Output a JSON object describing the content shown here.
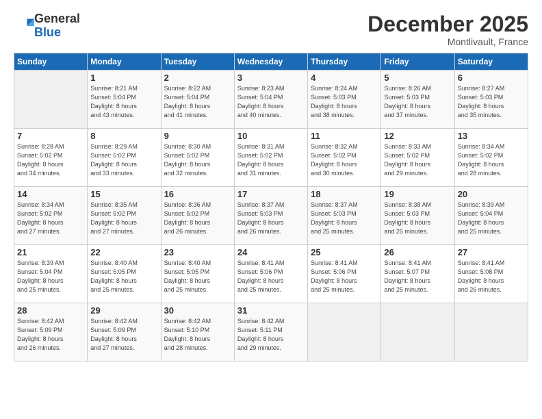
{
  "header": {
    "logo_general": "General",
    "logo_blue": "Blue",
    "month_title": "December 2025",
    "location": "Montlivault, France"
  },
  "days_of_week": [
    "Sunday",
    "Monday",
    "Tuesday",
    "Wednesday",
    "Thursday",
    "Friday",
    "Saturday"
  ],
  "weeks": [
    [
      {
        "day": "",
        "info": ""
      },
      {
        "day": "1",
        "info": "Sunrise: 8:21 AM\nSunset: 5:04 PM\nDaylight: 8 hours\nand 43 minutes."
      },
      {
        "day": "2",
        "info": "Sunrise: 8:22 AM\nSunset: 5:04 PM\nDaylight: 8 hours\nand 41 minutes."
      },
      {
        "day": "3",
        "info": "Sunrise: 8:23 AM\nSunset: 5:04 PM\nDaylight: 8 hours\nand 40 minutes."
      },
      {
        "day": "4",
        "info": "Sunrise: 8:24 AM\nSunset: 5:03 PM\nDaylight: 8 hours\nand 38 minutes."
      },
      {
        "day": "5",
        "info": "Sunrise: 8:26 AM\nSunset: 5:03 PM\nDaylight: 8 hours\nand 37 minutes."
      },
      {
        "day": "6",
        "info": "Sunrise: 8:27 AM\nSunset: 5:03 PM\nDaylight: 8 hours\nand 35 minutes."
      }
    ],
    [
      {
        "day": "7",
        "info": "Sunrise: 8:28 AM\nSunset: 5:02 PM\nDaylight: 8 hours\nand 34 minutes."
      },
      {
        "day": "8",
        "info": "Sunrise: 8:29 AM\nSunset: 5:02 PM\nDaylight: 8 hours\nand 33 minutes."
      },
      {
        "day": "9",
        "info": "Sunrise: 8:30 AM\nSunset: 5:02 PM\nDaylight: 8 hours\nand 32 minutes."
      },
      {
        "day": "10",
        "info": "Sunrise: 8:31 AM\nSunset: 5:02 PM\nDaylight: 8 hours\nand 31 minutes."
      },
      {
        "day": "11",
        "info": "Sunrise: 8:32 AM\nSunset: 5:02 PM\nDaylight: 8 hours\nand 30 minutes."
      },
      {
        "day": "12",
        "info": "Sunrise: 8:33 AM\nSunset: 5:02 PM\nDaylight: 8 hours\nand 29 minutes."
      },
      {
        "day": "13",
        "info": "Sunrise: 8:34 AM\nSunset: 5:02 PM\nDaylight: 8 hours\nand 28 minutes."
      }
    ],
    [
      {
        "day": "14",
        "info": "Sunrise: 8:34 AM\nSunset: 5:02 PM\nDaylight: 8 hours\nand 27 minutes."
      },
      {
        "day": "15",
        "info": "Sunrise: 8:35 AM\nSunset: 5:02 PM\nDaylight: 8 hours\nand 27 minutes."
      },
      {
        "day": "16",
        "info": "Sunrise: 8:36 AM\nSunset: 5:02 PM\nDaylight: 8 hours\nand 26 minutes."
      },
      {
        "day": "17",
        "info": "Sunrise: 8:37 AM\nSunset: 5:03 PM\nDaylight: 8 hours\nand 26 minutes."
      },
      {
        "day": "18",
        "info": "Sunrise: 8:37 AM\nSunset: 5:03 PM\nDaylight: 8 hours\nand 25 minutes."
      },
      {
        "day": "19",
        "info": "Sunrise: 8:38 AM\nSunset: 5:03 PM\nDaylight: 8 hours\nand 25 minutes."
      },
      {
        "day": "20",
        "info": "Sunrise: 8:39 AM\nSunset: 5:04 PM\nDaylight: 8 hours\nand 25 minutes."
      }
    ],
    [
      {
        "day": "21",
        "info": "Sunrise: 8:39 AM\nSunset: 5:04 PM\nDaylight: 8 hours\nand 25 minutes."
      },
      {
        "day": "22",
        "info": "Sunrise: 8:40 AM\nSunset: 5:05 PM\nDaylight: 8 hours\nand 25 minutes."
      },
      {
        "day": "23",
        "info": "Sunrise: 8:40 AM\nSunset: 5:05 PM\nDaylight: 8 hours\nand 25 minutes."
      },
      {
        "day": "24",
        "info": "Sunrise: 8:41 AM\nSunset: 5:06 PM\nDaylight: 8 hours\nand 25 minutes."
      },
      {
        "day": "25",
        "info": "Sunrise: 8:41 AM\nSunset: 5:06 PM\nDaylight: 8 hours\nand 25 minutes."
      },
      {
        "day": "26",
        "info": "Sunrise: 8:41 AM\nSunset: 5:07 PM\nDaylight: 8 hours\nand 25 minutes."
      },
      {
        "day": "27",
        "info": "Sunrise: 8:41 AM\nSunset: 5:08 PM\nDaylight: 8 hours\nand 26 minutes."
      }
    ],
    [
      {
        "day": "28",
        "info": "Sunrise: 8:42 AM\nSunset: 5:09 PM\nDaylight: 8 hours\nand 26 minutes."
      },
      {
        "day": "29",
        "info": "Sunrise: 8:42 AM\nSunset: 5:09 PM\nDaylight: 8 hours\nand 27 minutes."
      },
      {
        "day": "30",
        "info": "Sunrise: 8:42 AM\nSunset: 5:10 PM\nDaylight: 8 hours\nand 28 minutes."
      },
      {
        "day": "31",
        "info": "Sunrise: 8:42 AM\nSunset: 5:11 PM\nDaylight: 8 hours\nand 29 minutes."
      },
      {
        "day": "",
        "info": ""
      },
      {
        "day": "",
        "info": ""
      },
      {
        "day": "",
        "info": ""
      }
    ]
  ]
}
